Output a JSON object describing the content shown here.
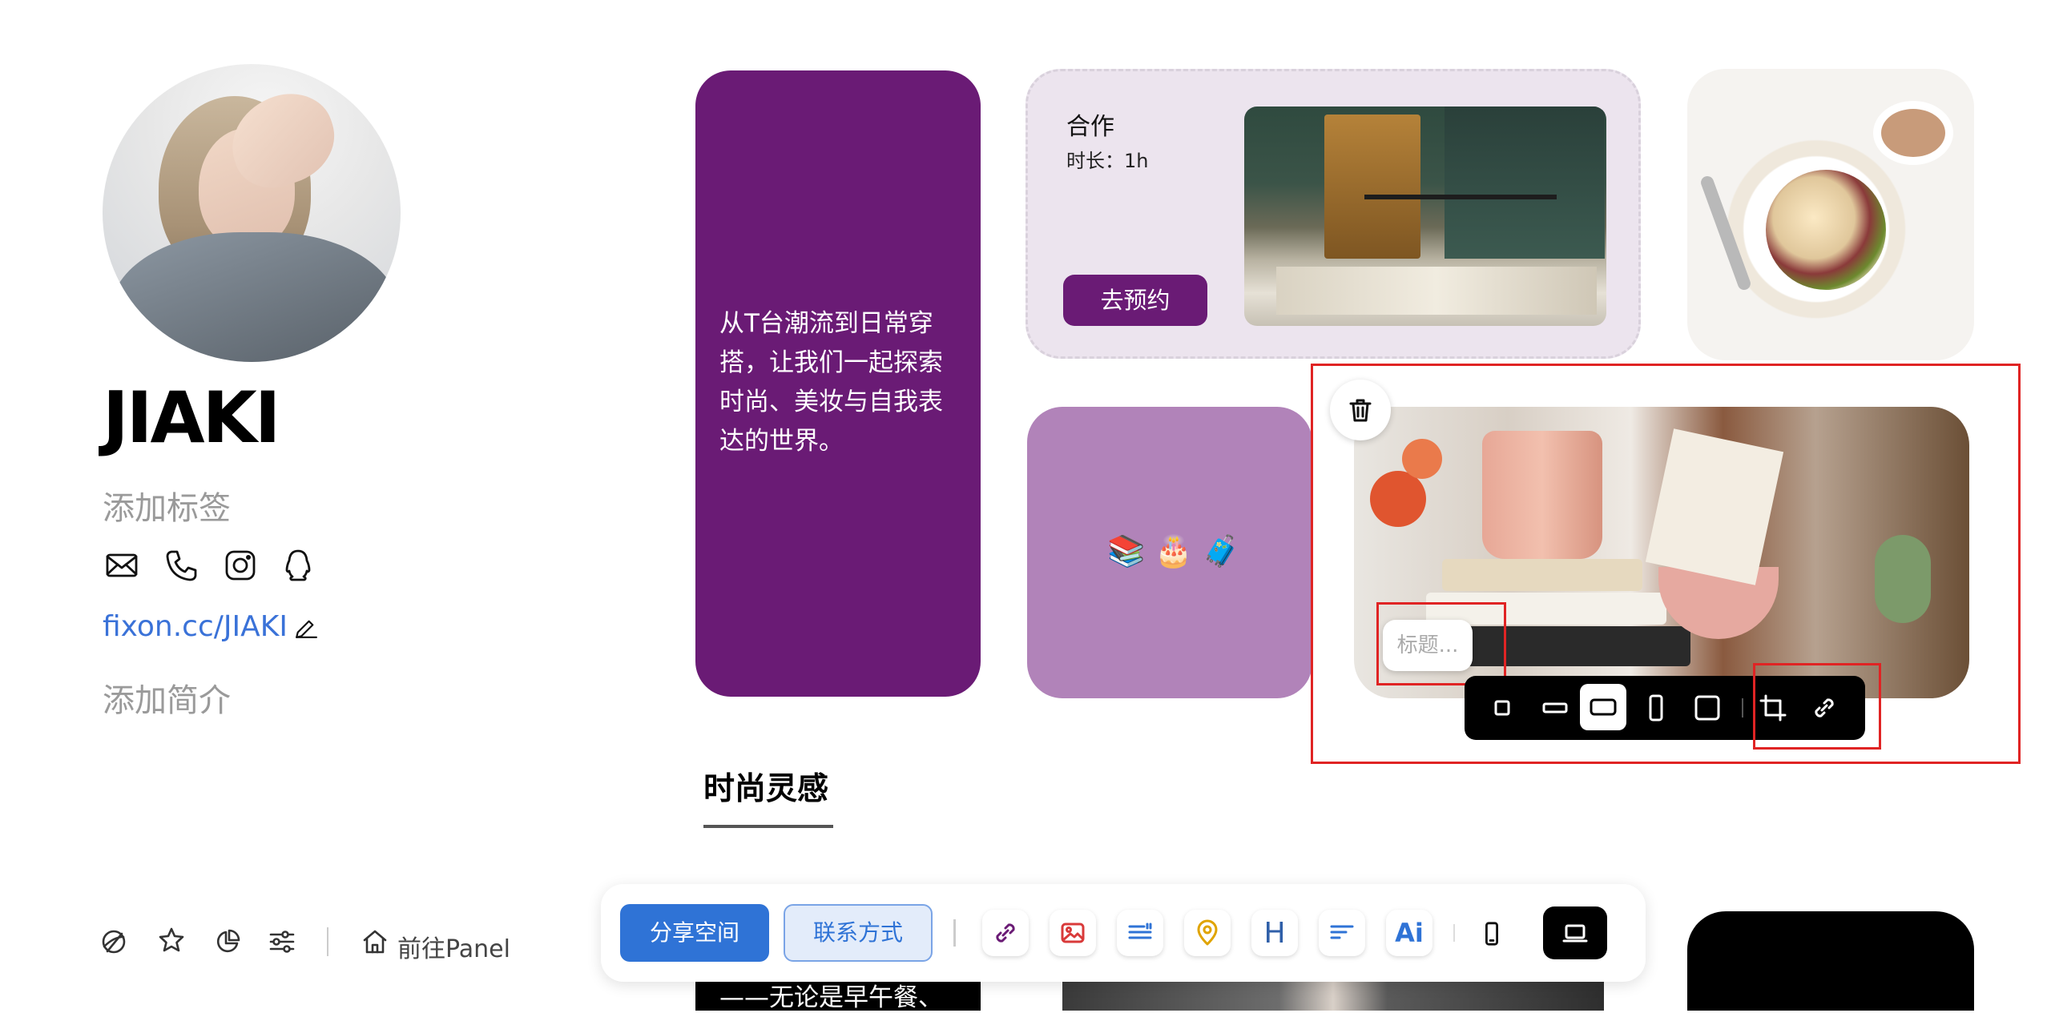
{
  "profile": {
    "name": "JIAKI",
    "add_tag": "添加标签",
    "link": "fixon.cc/JIAKI",
    "add_bio": "添加简介"
  },
  "cards": {
    "intro_text": "从T台潮流到日常穿搭，让我们一起探索时尚、美妆与自我表达的世界。",
    "collab_title": "合作",
    "collab_duration": "时长：1h",
    "collab_button": "去预约",
    "emoji_row": "📚 🎂 🧳",
    "image_title_placeholder": "标题..."
  },
  "section": {
    "tab_title": "时尚灵感",
    "bottom_text": "——无论是早午餐、"
  },
  "bottom_nav": {
    "panel_label": "前往Panel"
  },
  "dock": {
    "share_button": "分享空间",
    "contact_button": "联系方式",
    "heading_tool": "H",
    "ai_tool": "Ai"
  },
  "colors": {
    "accent_purple": "#6a1b75",
    "lilac": "#b183b9",
    "collab_bg": "#ece4ee",
    "link_blue": "#3a72d8",
    "share_blue": "#2f73d6",
    "selection_red": "#e02424"
  }
}
